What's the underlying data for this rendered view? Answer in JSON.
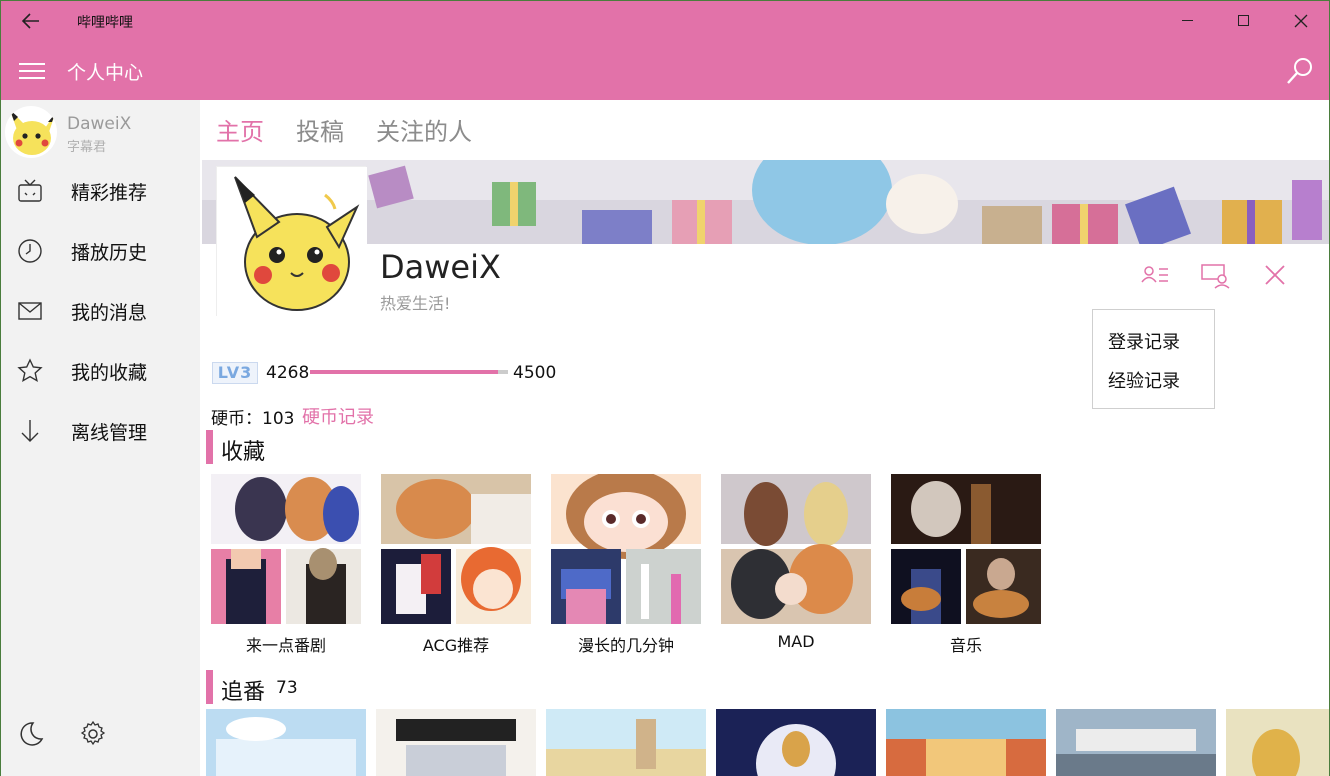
{
  "window": {
    "title": "哔哩哔哩"
  },
  "appbar": {
    "page_title": "个人中心"
  },
  "sidebar": {
    "user": {
      "name": "DaweiX",
      "title": "字幕君"
    },
    "items": [
      {
        "label": "精彩推荐",
        "icon": "tv-icon"
      },
      {
        "label": "播放历史",
        "icon": "clock-icon"
      },
      {
        "label": "我的消息",
        "icon": "mail-icon"
      },
      {
        "label": "我的收藏",
        "icon": "star-icon"
      },
      {
        "label": "离线管理",
        "icon": "download-icon"
      }
    ]
  },
  "tabs": [
    {
      "label": "主页"
    },
    {
      "label": "投稿"
    },
    {
      "label": "关注的人"
    }
  ],
  "profile": {
    "name": "DaweiX",
    "sign": "热爱生活!",
    "level_badge": "LV3",
    "exp_current": "4268",
    "exp_max": "4500",
    "exp_progress": 0.948,
    "coins": "硬币：103",
    "coin_link": "硬币记录"
  },
  "menu": {
    "items": [
      "登录记录",
      "经验记录"
    ]
  },
  "favorites": {
    "title": "收藏",
    "folders": [
      {
        "name": "来一点番剧"
      },
      {
        "name": "ACG推荐"
      },
      {
        "name": "漫长的几分钟"
      },
      {
        "name": "MAD"
      },
      {
        "name": "音乐"
      }
    ]
  },
  "bangumi": {
    "title": "追番",
    "count": "73"
  },
  "colors": {
    "accent": "#e272a9",
    "sidebar_bg": "#f2f2f2"
  }
}
